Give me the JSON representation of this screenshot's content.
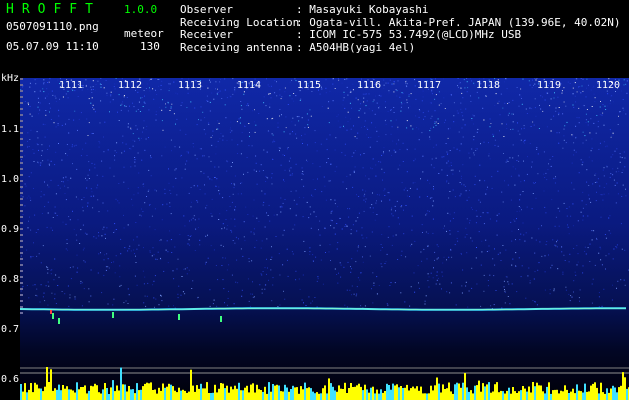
{
  "header": {
    "app_title": "HROFFT",
    "app_version": "1.0.0",
    "file_name": "0507091110.png",
    "mode": "meteor",
    "datetime": "05.07.09 11:10",
    "count": "130",
    "info": [
      {
        "label": "Observer",
        "value": ": Masayuki Kobayashi"
      },
      {
        "label": "Receiving Location",
        "value": ": Ogata-vill. Akita-Pref. JAPAN (139.96E, 40.02N)"
      },
      {
        "label": "Receiver",
        "value": ": ICOM IC-575 53.7492(@LCD)MHz USB"
      },
      {
        "label": "Receiving antenna",
        "value": ": A504HB(yagi 4el)"
      }
    ]
  },
  "axes": {
    "y_unit": "kHz",
    "y_ticks": [
      "1.1",
      "1.0",
      "0.9",
      "0.8",
      "0.7",
      "0.6"
    ],
    "x_ticks": [
      "1111",
      "1112",
      "1113",
      "1114",
      "1115",
      "1116",
      "1117",
      "1118",
      "1119",
      "1120"
    ]
  },
  "colors": {
    "title": "#00ff00",
    "spectrum_bg": "#00003a",
    "signal_line": "#40e0ff",
    "bottom_bars": "#ffff00"
  }
}
